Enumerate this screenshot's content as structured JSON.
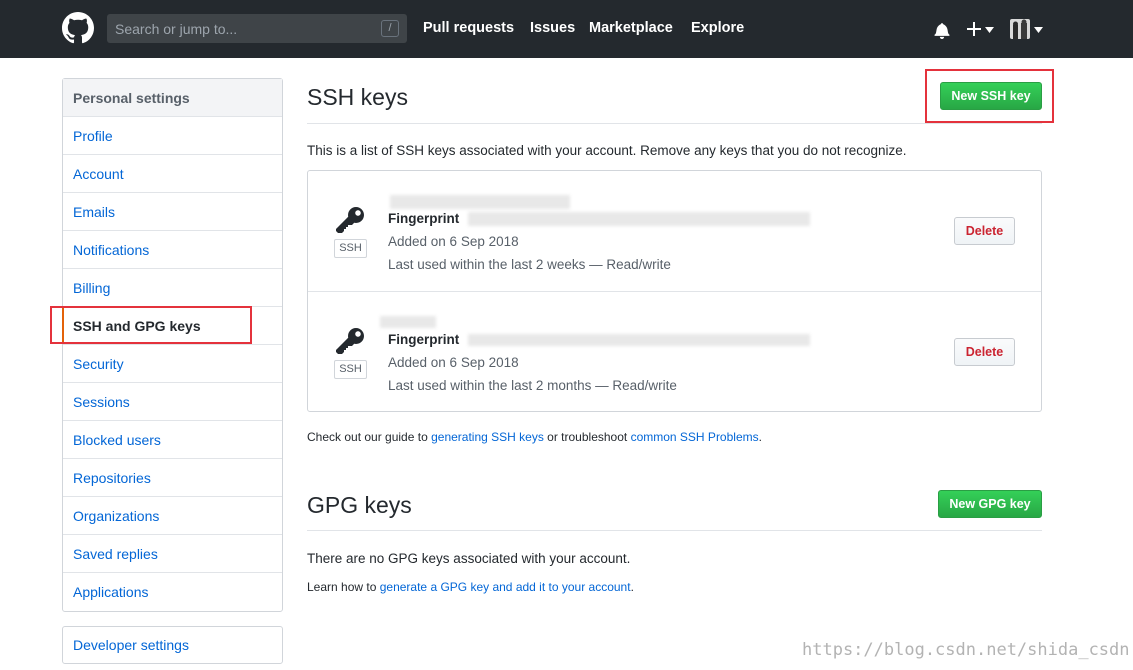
{
  "header": {
    "search_placeholder": "Search or jump to...",
    "search_shortcut": "/",
    "nav": [
      "Pull requests",
      "Issues",
      "Marketplace",
      "Explore"
    ]
  },
  "sidebar": {
    "heading": "Personal settings",
    "items": [
      {
        "label": "Profile"
      },
      {
        "label": "Account"
      },
      {
        "label": "Emails"
      },
      {
        "label": "Notifications"
      },
      {
        "label": "Billing"
      },
      {
        "label": "SSH and GPG keys",
        "selected": true
      },
      {
        "label": "Security"
      },
      {
        "label": "Sessions"
      },
      {
        "label": "Blocked users"
      },
      {
        "label": "Repositories"
      },
      {
        "label": "Organizations"
      },
      {
        "label": "Saved replies"
      },
      {
        "label": "Applications"
      }
    ],
    "developer_settings": "Developer settings"
  },
  "ssh": {
    "title": "SSH keys",
    "new_button": "New SSH key",
    "description": "This is a list of SSH keys associated with your account. Remove any keys that you do not recognize.",
    "keys": [
      {
        "badge": "SSH",
        "fingerprint_label": "Fingerprint",
        "added": "Added on 6 Sep 2018",
        "last_used": "Last used within the last 2 weeks — Read/write",
        "delete": "Delete"
      },
      {
        "badge": "SSH",
        "fingerprint_label": "Fingerprint",
        "added": "Added on 6 Sep 2018",
        "last_used": "Last used within the last 2 months — Read/write",
        "delete": "Delete"
      }
    ],
    "guide_prefix": "Check out our guide to",
    "guide_link1": "generating SSH keys",
    "guide_middle": "or troubleshoot",
    "guide_link2": "common SSH Problems",
    "guide_suffix": "."
  },
  "gpg": {
    "title": "GPG keys",
    "new_button": "New GPG key",
    "empty": "There are no GPG keys associated with your account.",
    "learn_prefix": "Learn how to",
    "learn_link": "generate a GPG key and add it to your account",
    "learn_suffix": "."
  },
  "watermark": "https://blog.csdn.net/shida_csdn",
  "colors": {
    "header_bg": "#24292e",
    "link": "#0366d6",
    "green": "#28a745",
    "danger": "#cb2431",
    "highlight_box": "#e4323c"
  }
}
